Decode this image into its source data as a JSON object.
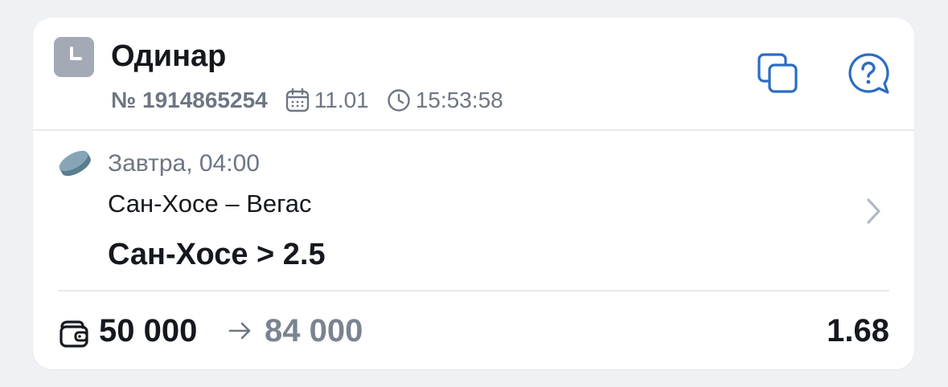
{
  "bet": {
    "type_label": "Одинар",
    "number": "№ 1914865254",
    "date": "11.01",
    "time": "15:53:58",
    "status_icon": "clock-icon"
  },
  "header_actions": {
    "copy_icon": "copy-icon",
    "help_icon": "help-bubble-icon"
  },
  "event": {
    "sport_icon": "hockey-puck-icon",
    "start": "Завтра, 04:00",
    "teams": "Сан-Хосе – Вегас",
    "outcome": "Сан-Хосе > 2.5"
  },
  "footer": {
    "wallet_icon": "wallet-icon",
    "stake": "50 000",
    "arrow": "→",
    "payout": "84 000",
    "coefficient": "1.68"
  },
  "colors": {
    "accent": "#2b6cc4",
    "status_gray": "#a3a9b5",
    "text_primary": "#15181e",
    "text_secondary": "#6e7684",
    "puck": "#6f93a6"
  }
}
